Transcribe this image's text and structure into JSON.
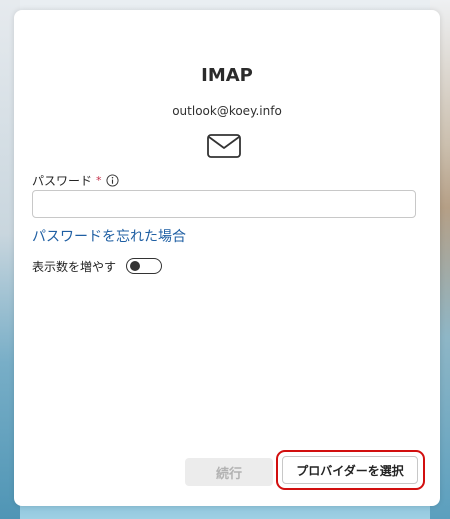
{
  "dialog": {
    "title": "IMAP",
    "email": "outlook@koey.info",
    "icon": "mail-icon"
  },
  "password": {
    "label": "パスワード",
    "required_mark": "*",
    "info_icon": "info-icon",
    "value": "",
    "placeholder": ""
  },
  "forgot_link": "パスワードを忘れた場合",
  "more_options": {
    "label": "表示数を増やす",
    "toggle_on": false
  },
  "buttons": {
    "continue": "続行",
    "choose_provider": "プロバイダーを選択"
  },
  "colors": {
    "link": "#1f5fa3",
    "required": "#c4314b",
    "highlight": "#d20f0f"
  }
}
